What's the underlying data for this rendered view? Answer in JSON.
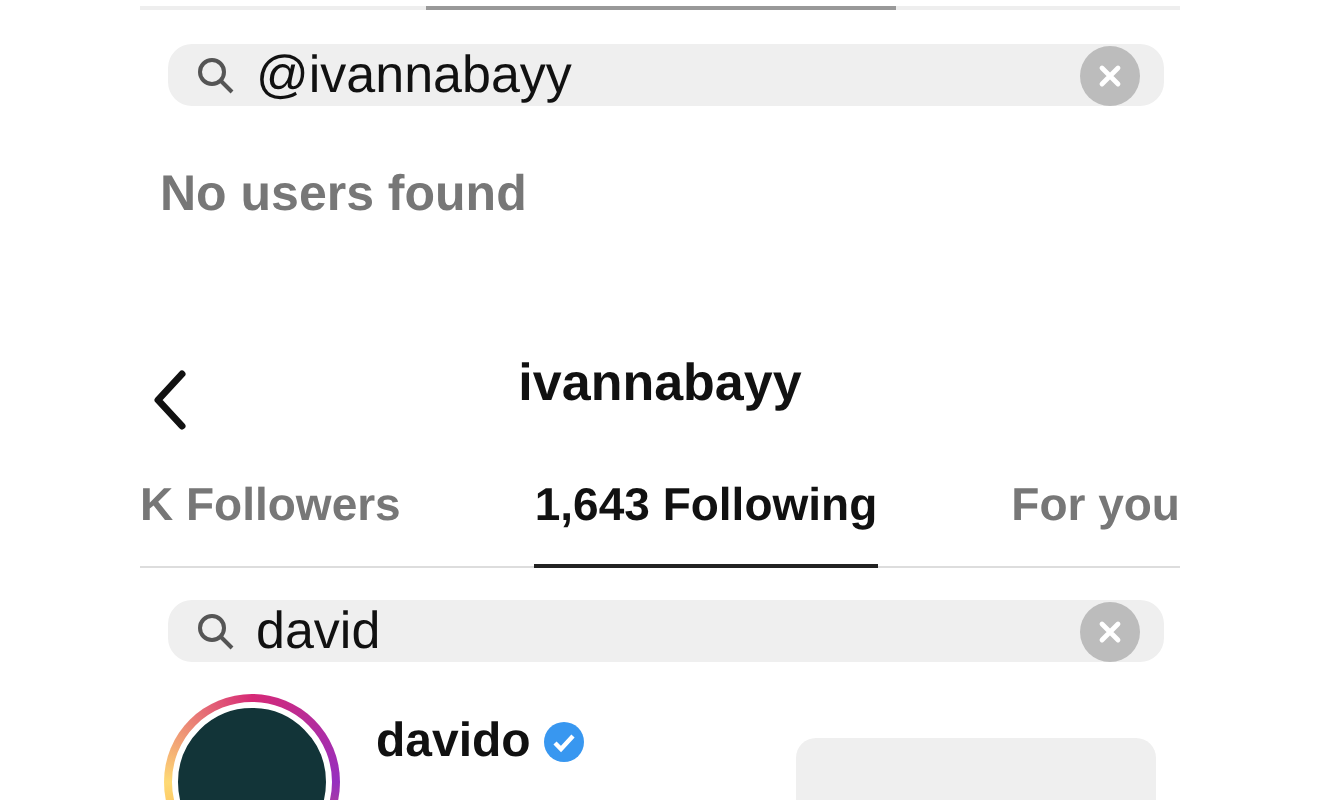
{
  "search_top": {
    "value": "@ivannabayy"
  },
  "no_results": "No users found",
  "header": {
    "title": "ivannabayy"
  },
  "tabs": [
    {
      "label": "K Followers",
      "selected": false
    },
    {
      "label": "1,643 Following",
      "selected": true
    },
    {
      "label": "For you",
      "selected": false
    }
  ],
  "search_bottom": {
    "value": "david"
  },
  "results": [
    {
      "username": "davido",
      "verified": true,
      "has_story": true
    }
  ]
}
